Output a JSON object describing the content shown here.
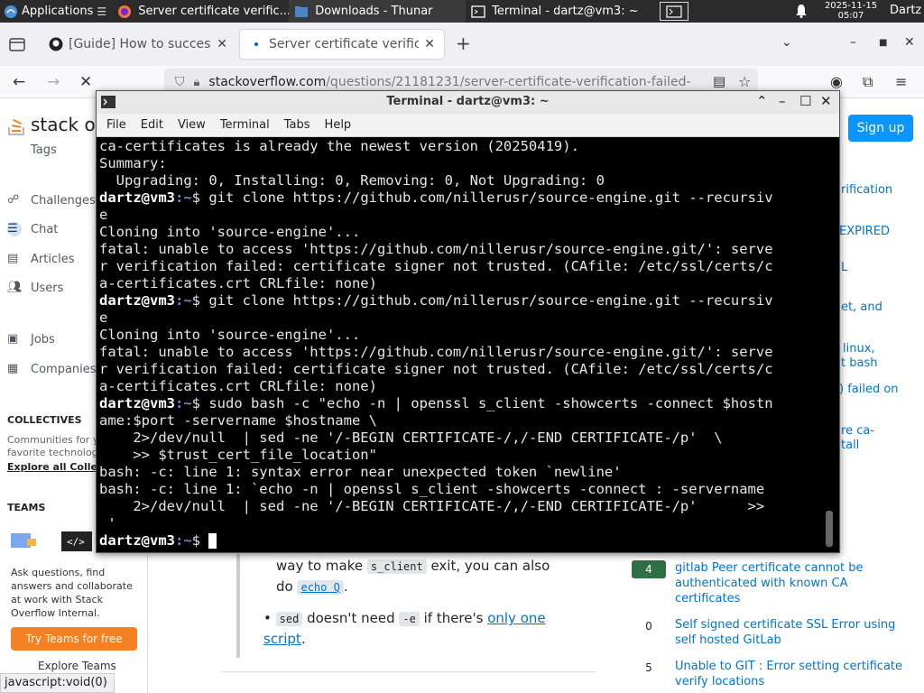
{
  "panel": {
    "applications_label": "Applications",
    "tasks": [
      {
        "title": "Server certificate verific..."
      },
      {
        "title": "Downloads - Thunar"
      },
      {
        "title": "Terminal - dartz@vm3: ~"
      }
    ],
    "clock_date": "2025-11-15",
    "clock_time": "05:07",
    "user": "Dartz"
  },
  "browser": {
    "tabs": [
      {
        "title": "[Guide] How to succesful"
      },
      {
        "title": "Server certificate verifica"
      }
    ],
    "url_host": "stackoverflow.com",
    "url_path": "/questions/21181231/server-certificate-verification-failed-"
  },
  "so": {
    "logo_text": "stack ove",
    "nav": {
      "tags": "Tags",
      "challenges": "Challenges",
      "chat": "Chat",
      "articles": "Articles",
      "users": "Users",
      "jobs": "Jobs",
      "companies": "Companies"
    },
    "collectives_header": "COLLECTIVES",
    "collectives_text": "Communities for your favorite technologies.",
    "explore_collectives": "Explore all Colle",
    "teams_header": "TEAMS",
    "teams_text": "Ask questions, find answers and collaborate at work with Stack Overflow Internal.",
    "teams_button": "Try Teams for free",
    "explore_teams": "Explore Teams",
    "signup": "Sign up",
    "partial_links": [
      "rification",
      "EXPIRED",
      "L",
      "et, and",
      "linux,",
      "t bash",
      ") failed on",
      "re ca-",
      "tall"
    ],
    "related": [
      {
        "count": "4",
        "answered": true,
        "title": "gitlab Peer certificate cannot be authenticated with known CA certificates"
      },
      {
        "count": "0",
        "answered": false,
        "title": "Self signed certificate SSL Error using self hosted GitLab"
      },
      {
        "count": "5",
        "answered": false,
        "title": "Unable to GIT : Error setting certificate verify locations"
      }
    ],
    "answer_frag": {
      "line1_pre": "way to make ",
      "line1_code": "s_client",
      "line1_post": " exit, you can also",
      "line2_pre": "do ",
      "line2_code": "echo Q",
      "line2_post": "."
    },
    "bullet": {
      "code1": "sed",
      "mid1": " doesn't need ",
      "code2": "-e",
      "mid2": " if there's ",
      "link": "only one script",
      "end": "."
    },
    "status_url": "javascript:void(0)"
  },
  "terminal": {
    "title": "Terminal - dartz@vm3: ~",
    "menu": [
      "File",
      "Edit",
      "View",
      "Terminal",
      "Tabs",
      "Help"
    ],
    "prompt_user": "dartz@vm3",
    "prompt_path": ":~",
    "prompt_symbol": "$ ",
    "lines": [
      {
        "type": "out",
        "text": "ca-certificates is already the newest version (20250419)."
      },
      {
        "type": "out",
        "text": "Summary:"
      },
      {
        "type": "out",
        "text": "  Upgrading: 0, Installing: 0, Removing: 0, Not Upgrading: 0"
      },
      {
        "type": "cmd",
        "text": "git clone https://github.com/nillerusr/source-engine.git --recursiv"
      },
      {
        "type": "out",
        "text": "e"
      },
      {
        "type": "out",
        "text": "Cloning into 'source-engine'..."
      },
      {
        "type": "out",
        "text": "fatal: unable to access 'https://github.com/nillerusr/source-engine.git/': serve"
      },
      {
        "type": "out",
        "text": "r verification failed: certificate signer not trusted. (CAfile: /etc/ssl/certs/c"
      },
      {
        "type": "out",
        "text": "a-certificates.crt CRLfile: none)"
      },
      {
        "type": "cmd",
        "text": "git clone https://github.com/nillerusr/source-engine.git --recursiv"
      },
      {
        "type": "out",
        "text": "e"
      },
      {
        "type": "out",
        "text": "Cloning into 'source-engine'..."
      },
      {
        "type": "out",
        "text": "fatal: unable to access 'https://github.com/nillerusr/source-engine.git/': serve"
      },
      {
        "type": "out",
        "text": "r verification failed: certificate signer not trusted. (CAfile: /etc/ssl/certs/c"
      },
      {
        "type": "out",
        "text": "a-certificates.crt CRLfile: none)"
      },
      {
        "type": "cmd",
        "text": "sudo bash -c \"echo -n | openssl s_client -showcerts -connect $hostn"
      },
      {
        "type": "out",
        "text": "ame:$port -servername $hostname \\"
      },
      {
        "type": "out",
        "text": "    2>/dev/null  | sed -ne '/-BEGIN CERTIFICATE-/,/-END CERTIFICATE-/p'  \\"
      },
      {
        "type": "out",
        "text": "    >> $trust_cert_file_location\""
      },
      {
        "type": "out",
        "text": "bash: -c: line 1: syntax error near unexpected token `newline'"
      },
      {
        "type": "out",
        "text": "bash: -c: line 1: `echo -n | openssl s_client -showcerts -connect : -servername"
      },
      {
        "type": "out",
        "text": "    2>/dev/null  | sed -ne '/-BEGIN CERTIFICATE-/,/-END CERTIFICATE-/p'      >>"
      },
      {
        "type": "out",
        "text": " '"
      },
      {
        "type": "prompt",
        "text": ""
      }
    ]
  }
}
